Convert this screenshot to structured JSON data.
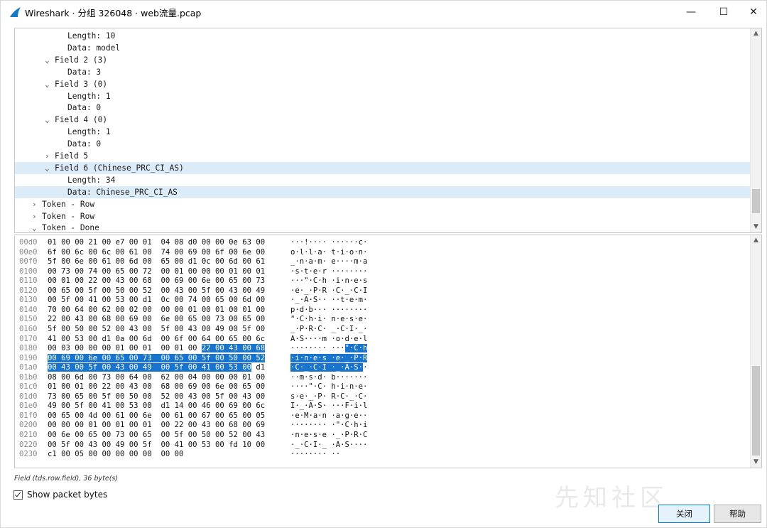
{
  "window": {
    "title": "Wireshark · 分组 326048 · web流量.pcap",
    "controls": {
      "minimize": "—",
      "maximize": "☐",
      "close": "✕"
    }
  },
  "tree": [
    {
      "indent": 3,
      "chevron": "",
      "text": "Length: 10"
    },
    {
      "indent": 3,
      "chevron": "",
      "text": "Data: model"
    },
    {
      "indent": 2,
      "chevron": "⌄",
      "text": "Field 2 (3)"
    },
    {
      "indent": 3,
      "chevron": "",
      "text": "Data: 3"
    },
    {
      "indent": 2,
      "chevron": "⌄",
      "text": "Field 3 (0)"
    },
    {
      "indent": 3,
      "chevron": "",
      "text": "Length: 1"
    },
    {
      "indent": 3,
      "chevron": "",
      "text": "Data: 0"
    },
    {
      "indent": 2,
      "chevron": "⌄",
      "text": "Field 4 (0)"
    },
    {
      "indent": 3,
      "chevron": "",
      "text": "Length: 1"
    },
    {
      "indent": 3,
      "chevron": "",
      "text": "Data: 0"
    },
    {
      "indent": 2,
      "chevron": "›",
      "text": "Field 5"
    },
    {
      "indent": 2,
      "chevron": "⌄",
      "text": "Field 6 (Chinese_PRC_CI_AS)",
      "selected": "row"
    },
    {
      "indent": 3,
      "chevron": "",
      "text": "Length: 34"
    },
    {
      "indent": 3,
      "chevron": "",
      "text": "Data: Chinese_PRC_CI_AS",
      "selected": "row"
    },
    {
      "indent": 1,
      "chevron": "›",
      "text": "Token - Row"
    },
    {
      "indent": 1,
      "chevron": "›",
      "text": "Token - Row"
    },
    {
      "indent": 1,
      "chevron": "⌄",
      "text": "Token - Done"
    }
  ],
  "hex": [
    {
      "off": "00d0",
      "hex": "01 00 00 21 00 e7 00 01  04 08 d0 00 00 0e 63 00",
      "asc": "···!···· ······c·"
    },
    {
      "off": "00e0",
      "hex": "6f 00 6c 00 6c 00 61 00  74 00 69 00 6f 00 6e 00",
      "asc": "o·l·l·a· t·i·o·n·"
    },
    {
      "off": "00f0",
      "hex": "5f 00 6e 00 61 00 6d 00  65 00 d1 0c 00 6d 00 61",
      "asc": "_·n·a·m· e····m·a"
    },
    {
      "off": "0100",
      "hex": "00 73 00 74 00 65 00 72  00 01 00 00 00 01 00 01",
      "asc": "·s·t·e·r ········"
    },
    {
      "off": "0110",
      "hex": "00 01 00 22 00 43 00 68  00 69 00 6e 00 65 00 73",
      "asc": "···\"·C·h ·i·n·e·s"
    },
    {
      "off": "0120",
      "hex": "00 65 00 5f 00 50 00 52  00 43 00 5f 00 43 00 49",
      "asc": "·e·_·P·R ·C·_·C·I"
    },
    {
      "off": "0130",
      "hex": "00 5f 00 41 00 53 00 d1  0c 00 74 00 65 00 6d 00",
      "asc": "·_·A·S·· ··t·e·m·"
    },
    {
      "off": "0140",
      "hex": "70 00 64 00 62 00 02 00  00 00 01 00 01 00 01 00",
      "asc": "p·d·b··· ········"
    },
    {
      "off": "0150",
      "hex": "22 00 43 00 68 00 69 00  6e 00 65 00 73 00 65 00",
      "asc": "\"·C·h·i· n·e·s·e·"
    },
    {
      "off": "0160",
      "hex": "5f 00 50 00 52 00 43 00  5f 00 43 00 49 00 5f 00",
      "asc": "_·P·R·C· _·C·I·_·"
    },
    {
      "off": "0170",
      "hex": "41 00 53 00 d1 0a 00 6d  00 6f 00 64 00 65 00 6c",
      "asc": "A·S····m ·o·d·e·l"
    },
    {
      "off": "0180",
      "hex": "00 03 00 00 00 01 00 01  00 01 00 22 00 43 00 68",
      "asc": "········ ···\"·C·h",
      "hexPlain": "00 03 00 00 00 01 00 01  00 01 00 ",
      "hexHl": "22 00 43 00 68",
      "ascPlain": "········ ···",
      "ascHl": "\"·C·h"
    },
    {
      "off": "0190",
      "hex": "00 69 00 6e 00 65 00 73  00 65 00 5f 00 50 00 52",
      "asc": "·i·n·e·s ·e·_·P·R",
      "hexHl": "00 69 00 6e 00 65 00 73  00 65 00 5f 00 50 00 52",
      "ascHl": "·i·n·e·s ·e·_·P·R"
    },
    {
      "off": "01a0",
      "hex": "00 43 00 5f 00 43 00 49  00 5f 00 41 00 53 00 d1",
      "asc": "·C·_·C·I ·_·A·S··",
      "hexHl": "00 43 00 5f 00 43 00 49  00 5f 00 41 00 53 00",
      "hexPost": " d1",
      "ascHl": "·C·_·C·I ·_·A·S·",
      "ascPost": "·"
    },
    {
      "off": "01b0",
      "hex": "08 00 6d 00 73 00 64 00  62 00 04 00 00 00 01 00",
      "asc": "··m·s·d· b·······"
    },
    {
      "off": "01c0",
      "hex": "01 00 01 00 22 00 43 00  68 00 69 00 6e 00 65 00",
      "asc": "····\"·C· h·i·n·e·"
    },
    {
      "off": "01d0",
      "hex": "73 00 65 00 5f 00 50 00  52 00 43 00 5f 00 43 00",
      "asc": "s·e·_·P· R·C·_·C·"
    },
    {
      "off": "01e0",
      "hex": "49 00 5f 00 41 00 53 00  d1 14 00 46 00 69 00 6c",
      "asc": "I·_·A·S· ···F·i·l"
    },
    {
      "off": "01f0",
      "hex": "00 65 00 4d 00 61 00 6e  00 61 00 67 00 65 00 05",
      "asc": "·e·M·a·n ·a·g·e··"
    },
    {
      "off": "0200",
      "hex": "00 00 00 01 00 01 00 01  00 22 00 43 00 68 00 69",
      "asc": "········ ·\"·C·h·i"
    },
    {
      "off": "0210",
      "hex": "00 6e 00 65 00 73 00 65  00 5f 00 50 00 52 00 43",
      "asc": "·n·e·s·e ·_·P·R·C"
    },
    {
      "off": "0220",
      "hex": "00 5f 00 43 00 49 00 5f  00 41 00 53 00 fd 10 00",
      "asc": "·_·C·I·_ ·A·S····"
    },
    {
      "off": "0230",
      "hex": "c1 00 05 00 00 00 00 00  00 00",
      "asc": "········ ··"
    }
  ],
  "status": {
    "field_text": "Field (tds.row.field), 36 byte(s)"
  },
  "options": {
    "show_packet_bytes": "Show packet bytes"
  },
  "buttons": {
    "close": "关闭",
    "help": "帮助"
  },
  "watermark": "先知社区",
  "colors": {
    "selection": "#1874cd",
    "tree_highlight": "#dcebf8",
    "accent": "#0078d7"
  }
}
